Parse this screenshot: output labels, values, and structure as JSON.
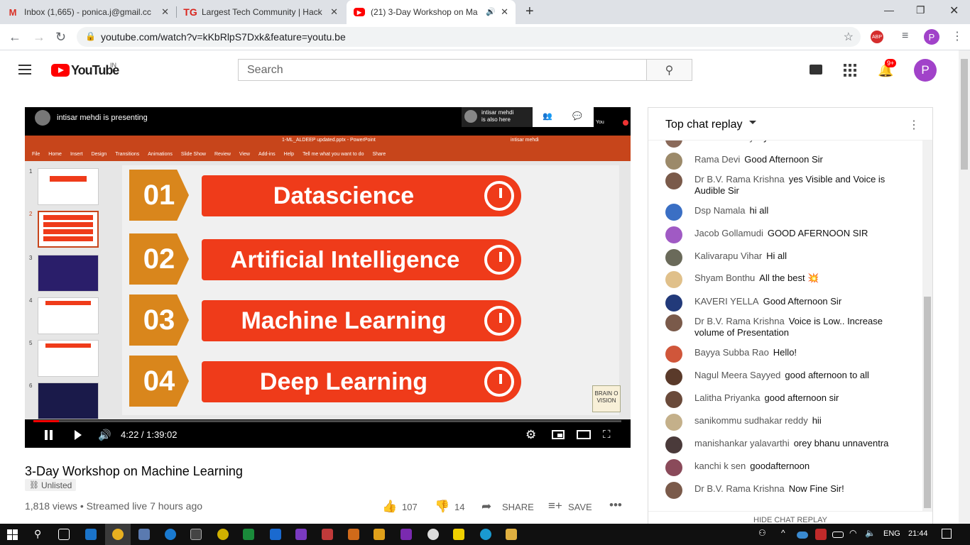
{
  "browser": {
    "tabs": [
      {
        "icon": "M",
        "title": "Inbox (1,665) - ponica.j@gmail.cc"
      },
      {
        "icon": "TG",
        "title": "Largest Tech Community | Hackat"
      },
      {
        "icon": "▶",
        "title": "(21) 3-Day Workshop on Ma"
      }
    ],
    "url": "youtube.com/watch?v=kKbRlpS7Dxk&feature=youtu.be"
  },
  "youtube": {
    "brand": "YouTube",
    "region": "IN",
    "search_placeholder": "Search",
    "notif_badge": "9+",
    "avatar": "P"
  },
  "player": {
    "presenter": "intisar mehdi is presenting",
    "also_here": "intisar mehdi\nis also here",
    "you_label": "You",
    "ppt_title": "1-ML_ALDEEP updated.pptx - PowerPoint",
    "ppt_user": "intisar mehdi",
    "ppt_menu": [
      "File",
      "Home",
      "Insert",
      "Design",
      "Transitions",
      "Animations",
      "Slide Show",
      "Review",
      "View",
      "Add-ins",
      "Help",
      "Tell me what you want to do",
      "Share"
    ],
    "slide_rows": [
      {
        "num": "01",
        "label": "Datascience"
      },
      {
        "num": "02",
        "label": "Artificial Intelligence"
      },
      {
        "num": "03",
        "label": "Machine Learning"
      },
      {
        "num": "04",
        "label": "Deep Learning"
      }
    ],
    "thumb_numbers": [
      "1",
      "2",
      "3",
      "4",
      "5",
      "6"
    ],
    "logo_text": "BRAIN O VISION",
    "time": "4:22 / 1:39:02",
    "progress_fraction": 0.044
  },
  "video": {
    "title": "3-Day Workshop on Machine Learning",
    "badge": "Unlisted",
    "meta": "1,818 views • Streamed live 7 hours ago",
    "likes": "107",
    "dislikes": "14",
    "share": "SHARE",
    "save": "SAVE"
  },
  "chat": {
    "header": "Top chat replay",
    "hide": "HIDE CHAT REPLAY",
    "messages": [
      {
        "author": "Mohana Sravya",
        "text": "yes sir",
        "color": "#8a6a5a"
      },
      {
        "author": "Rama Devi",
        "text": "Good Afternoon Sir",
        "color": "#9c8a6a"
      },
      {
        "author": "Dr B.V. Rama Krishna",
        "text": "yes Visible and Voice is Audible Sir",
        "color": "#7a5a4a"
      },
      {
        "author": "Dsp Namala",
        "text": "hi all",
        "color": "#3a6fc4"
      },
      {
        "author": "Jacob Gollamudi",
        "text": "GOOD AFERNOON SIR",
        "color": "#a05ac4"
      },
      {
        "author": "Kalivarapu Vihar",
        "text": "Hi all",
        "color": "#6a6a5a"
      },
      {
        "author": "Shyam Bonthu",
        "text": "All the best 💥",
        "color": "#e0c08a"
      },
      {
        "author": "KAVERI YELLA",
        "text": "Good Afternoon Sir",
        "color": "#223a7a"
      },
      {
        "author": "Dr B.V. Rama Krishna",
        "text": "Voice is Low.. Increase volume of Presentation",
        "color": "#7a5a4a"
      },
      {
        "author": "Bayya Subba Rao",
        "text": "Hello!",
        "color": "#d0563a"
      },
      {
        "author": "Nagul Meera Sayyed",
        "text": "good afternoon to all",
        "color": "#5a3a2a"
      },
      {
        "author": "Lalitha Priyanka",
        "text": "good afternoon sir",
        "color": "#6a4a3a"
      },
      {
        "author": "sanikommu sudhakar reddy",
        "text": "hii",
        "color": "#c4b08a"
      },
      {
        "author": "manishankar yalavarthi",
        "text": "orey bhanu unnaventra",
        "color": "#4a3a3a"
      },
      {
        "author": "kanchi k sen",
        "text": "goodafternoon",
        "color": "#8a4a5a"
      },
      {
        "author": "Dr B.V. Rama Krishna",
        "text": "Now Fine Sir!",
        "color": "#7a5a4a"
      }
    ]
  },
  "taskbar": {
    "lang": "ENG",
    "time": "21:44"
  }
}
